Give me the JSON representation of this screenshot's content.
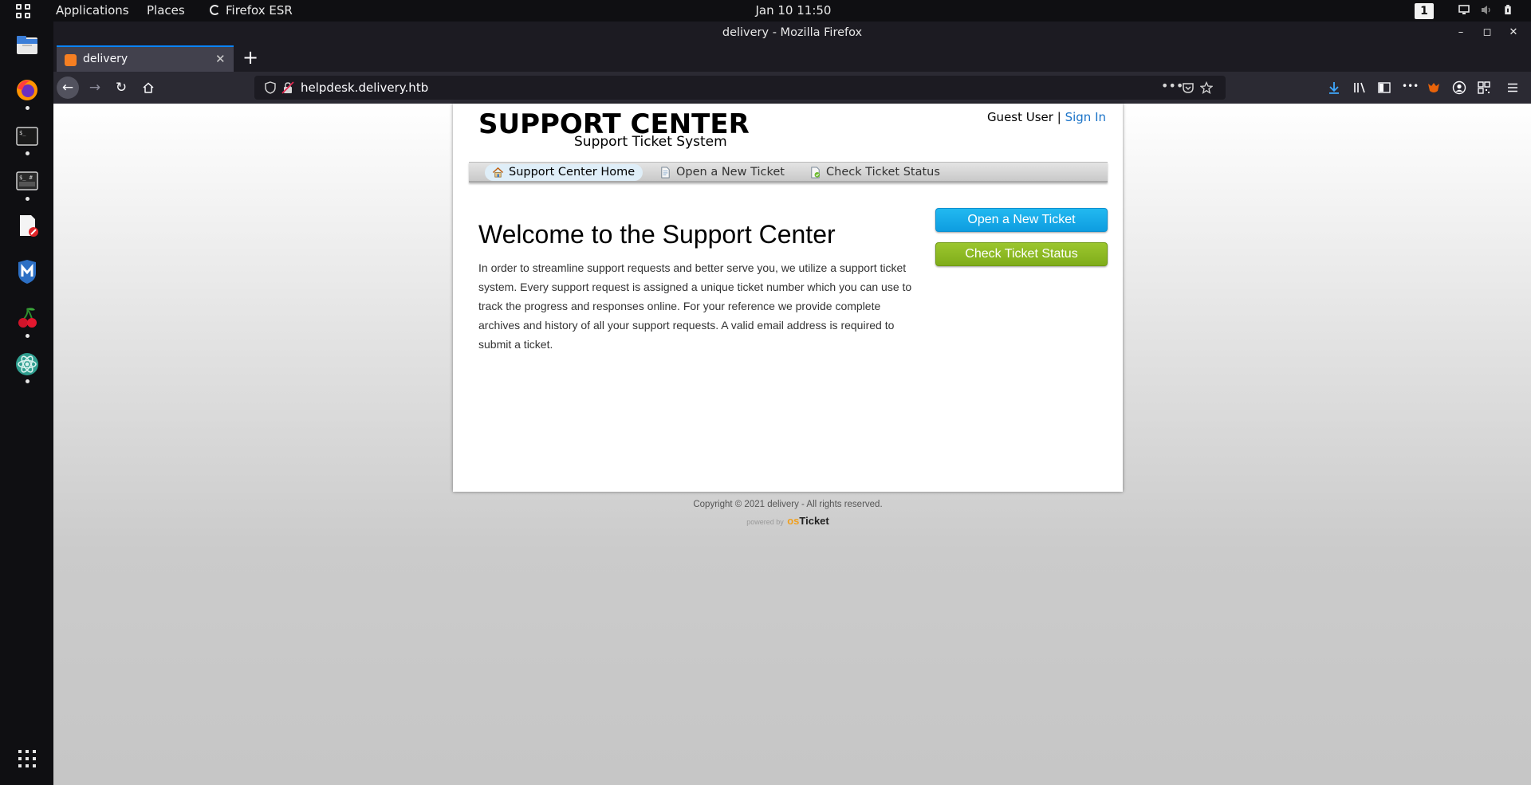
{
  "topbar": {
    "applications": "Applications",
    "places": "Places",
    "firefox_app": "Firefox ESR",
    "clock": "Jan 10  11:50",
    "workspace": "1"
  },
  "window": {
    "title": "delivery - Mozilla Firefox"
  },
  "tab": {
    "label": "delivery"
  },
  "urlbar": {
    "url": "helpdesk.delivery.htb"
  },
  "page": {
    "logo_title": "SUPPORT CENTER",
    "logo_subtitle": "Support Ticket System",
    "user_label": "Guest User",
    "user_sep": "|",
    "sign_in": "Sign In",
    "nav": [
      {
        "label": "Support Center Home"
      },
      {
        "label": "Open a New Ticket"
      },
      {
        "label": "Check Ticket Status"
      }
    ],
    "heading": "Welcome to the Support Center",
    "intro": "In order to streamline support requests and better serve you, we utilize a support ticket system. Every support request is assigned a unique ticket number which you can use to track the progress and responses online. For your reference we provide complete archives and history of all your support requests. A valid email address is required to submit a ticket.",
    "btn_open": "Open a New Ticket",
    "btn_check": "Check Ticket Status",
    "copyright": "Copyright © 2021 delivery - All rights reserved.",
    "powered_by": "powered by",
    "powered_brand_a": "os",
    "powered_brand_b": "Ticket"
  },
  "colors": {
    "accent_blue": "#0a84ff",
    "signin_link": "#1a73c8",
    "btn_blue": "#0e9de0",
    "btn_green": "#80ad1a"
  }
}
